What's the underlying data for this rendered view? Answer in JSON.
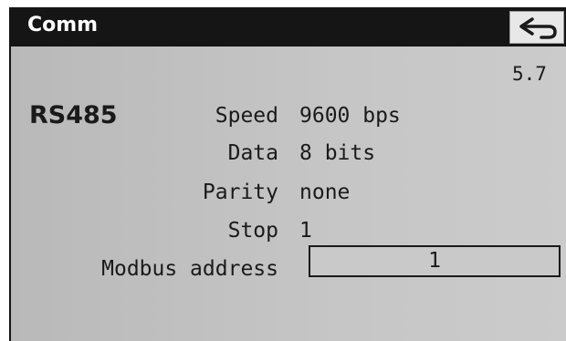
{
  "header": {
    "title": "Comm",
    "back_icon": "back-arrow-icon"
  },
  "version": "5.7",
  "interface": "RS485",
  "settings": {
    "speed": {
      "label": "Speed",
      "value": "9600 bps"
    },
    "data": {
      "label": "Data",
      "value": "8 bits"
    },
    "parity": {
      "label": "Parity",
      "value": "none"
    },
    "stop": {
      "label": "Stop",
      "value": "1"
    },
    "modbus_address": {
      "label": "Modbus address",
      "value": "1"
    }
  },
  "colors": {
    "titlebar": "#151515",
    "background": "#c6c6c6",
    "text": "#1a1a1a"
  }
}
